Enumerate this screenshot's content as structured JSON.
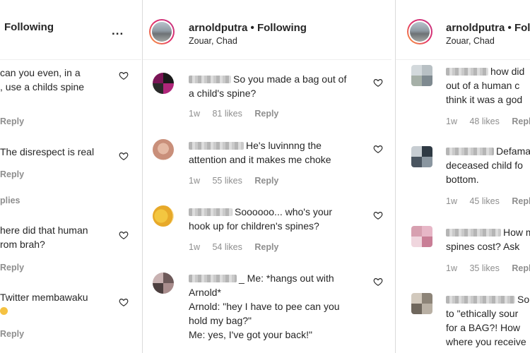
{
  "colors": {
    "accent": "#262626",
    "muted": "#8e8e8e",
    "story_ring": "#e1306c"
  },
  "left_panel": {
    "header": {
      "following": "Following",
      "more_label": "..."
    },
    "comments": [
      {
        "lines": [
          "can you even, in a",
          ", use a childs spine"
        ],
        "reply": "Reply"
      },
      {
        "lines": [
          "The disrespect is real"
        ],
        "reply": "Reply"
      },
      {
        "lines": [
          "here did that human",
          "rom brah?"
        ],
        "reply": "Reply"
      },
      {
        "lines": [
          "Twitter membawaku",
          ""
        ],
        "reply": "Reply"
      }
    ],
    "replies_label": "plies"
  },
  "mid_panel": {
    "header": {
      "username": "arnoldputra",
      "dot": "•",
      "following": "Following",
      "location": "Zouar, Chad"
    },
    "comments": [
      {
        "first": "So you made a bag out of",
        "rest": [
          "a child's spine?"
        ],
        "time": "1w",
        "likes": "81 likes",
        "reply": "Reply"
      },
      {
        "first": "He's luvinnng the",
        "rest": [
          "attention and it makes me choke"
        ],
        "time": "1w",
        "likes": "55 likes",
        "reply": "Reply"
      },
      {
        "first": "Soooooo... who's your",
        "rest": [
          "hook up for children's spines?"
        ],
        "time": "1w",
        "likes": "54 likes",
        "reply": "Reply"
      },
      {
        "first": "_ Me: *hangs out with",
        "rest": [
          "Arnold*",
          "Arnold: \"hey I have to pee can you",
          "hold my bag?\"",
          "Me: yes, I've got your back!\""
        ],
        "time": "",
        "likes": "",
        "reply": ""
      }
    ]
  },
  "right_panel": {
    "header": {
      "username": "arnoldputra",
      "dot": "•",
      "following": "Following",
      "location": "Zouar, Chad"
    },
    "comments": [
      {
        "first": "how did",
        "rest": [
          "out of a human c",
          "think it was a god"
        ],
        "time": "1w",
        "likes": "48 likes",
        "reply": "Reply"
      },
      {
        "first": "Defamat",
        "rest": [
          "deceased child fo",
          "bottom."
        ],
        "time": "1w",
        "likes": "45 likes",
        "reply": "Reply"
      },
      {
        "first": "How m",
        "rest": [
          "spines cost? Ask"
        ],
        "time": "1w",
        "likes": "35 likes",
        "reply": "Reply"
      },
      {
        "first": "So",
        "rest": [
          "to \"ethically sour",
          "for a BAG?! How",
          "where you receive"
        ],
        "time": "",
        "likes": "",
        "reply": ""
      }
    ]
  }
}
